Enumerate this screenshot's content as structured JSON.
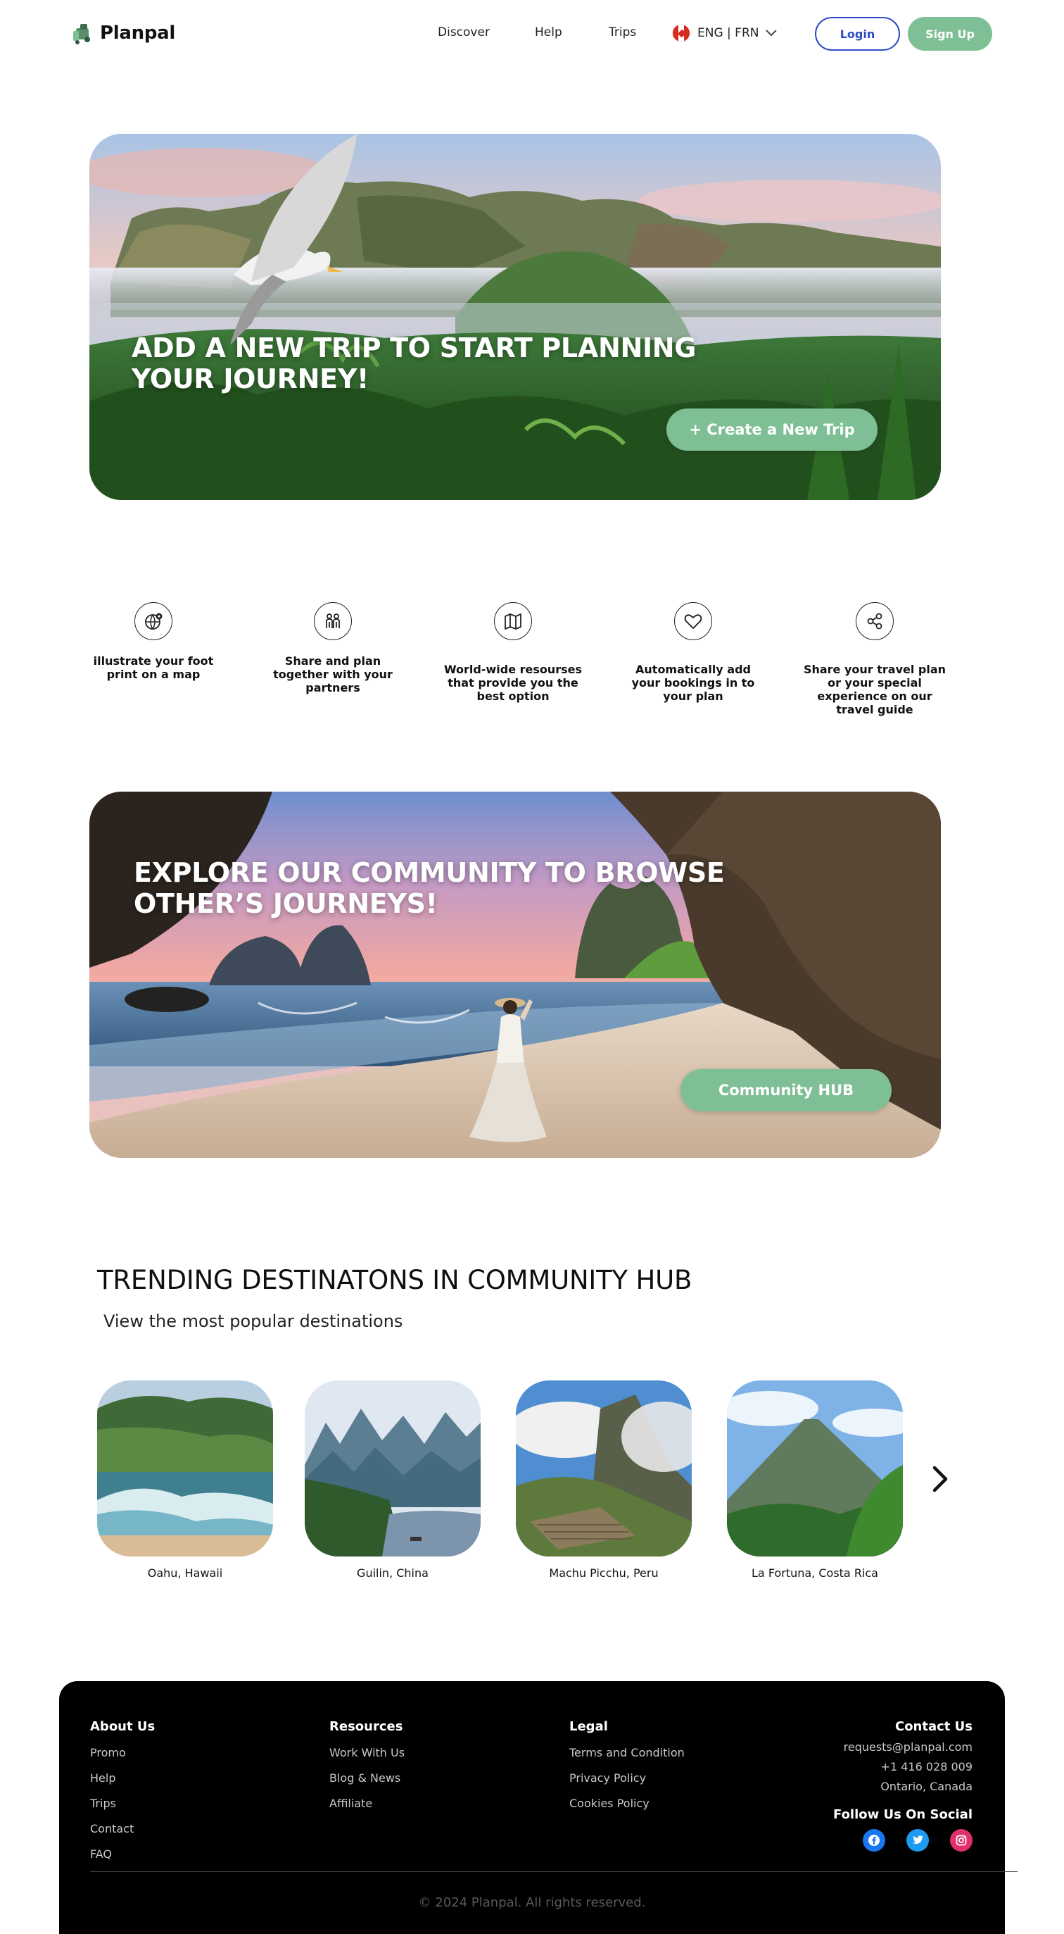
{
  "brand": {
    "name": "Planpal",
    "accent": "#7fbf95",
    "link_blue": "#2d4cc8"
  },
  "nav": {
    "links": [
      "Discover",
      "Help",
      "Trips"
    ],
    "language": "ENG | FRN",
    "login": "Login",
    "signup": "Sign Up"
  },
  "hero_trip": {
    "title_line1": "ADD A NEW TRIP TO START PLANNING",
    "title_line2": "YOUR JOURNEY!",
    "button": "+ Create a New Trip"
  },
  "features": [
    {
      "icon": "globe-pin-icon",
      "text": "illustrate your foot print on a map"
    },
    {
      "icon": "couple-icon",
      "text": "Share and plan together with your partners"
    },
    {
      "icon": "map-icon",
      "text": "World-wide resourses that provide you the best option"
    },
    {
      "icon": "heart-icon",
      "text": "Automatically add your bookings in to your plan"
    },
    {
      "icon": "share-icon",
      "text": "Share your travel plan or your special experience on our travel guide"
    }
  ],
  "hero_community": {
    "title_line1": "EXPLORE OUR COMMUNITY TO BROWSE",
    "title_line2": "OTHER’S JOURNEYS!",
    "button": "Community HUB"
  },
  "trending": {
    "title": "TRENDING DESTINATONS IN COMMUNITY HUB",
    "subtitle": "View the most popular destinations",
    "destinations": [
      {
        "name": "Oahu, Hawaii"
      },
      {
        "name": "Guilin, China"
      },
      {
        "name": "Machu Picchu, Peru"
      },
      {
        "name": "La Fortuna, Costa Rica"
      }
    ]
  },
  "footer": {
    "about": {
      "title": "About Us",
      "links": [
        "Promo",
        "Help",
        "Trips",
        "Contact",
        "FAQ"
      ]
    },
    "resources": {
      "title": "Resources",
      "links": [
        "Work With Us",
        "Blog & News",
        "Affiliate"
      ]
    },
    "legal": {
      "title": "Legal",
      "links": [
        "Terms and Condition",
        "Privacy Policy",
        "Cookies Policy"
      ]
    },
    "contact": {
      "title": "Contact Us",
      "email": "requests@planpal.com",
      "phone": "+1 416 028 009",
      "location": "Ontario, Canada"
    },
    "social_title": "Follow Us On Social",
    "social": [
      {
        "icon": "facebook-icon",
        "color": "#1877f2"
      },
      {
        "icon": "twitter-icon",
        "color": "#1d9bf0"
      },
      {
        "icon": "instagram-icon",
        "color": "#e1306c"
      }
    ],
    "copyright": "© 2024 Planpal. All rights reserved."
  }
}
